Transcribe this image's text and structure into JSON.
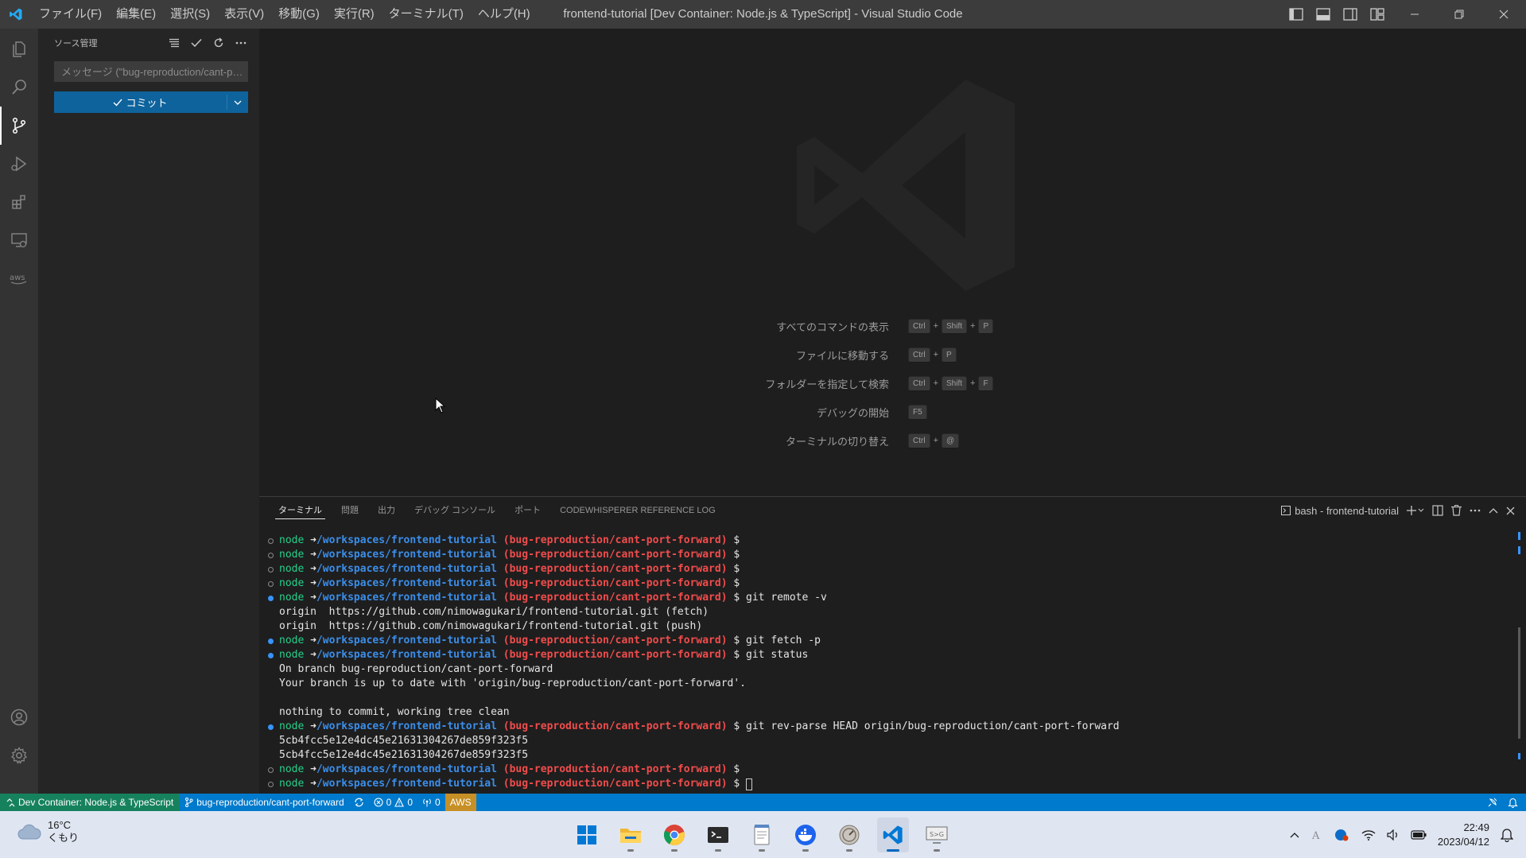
{
  "window": {
    "title": "frontend-tutorial [Dev Container: Node.js & TypeScript] - Visual Studio Code",
    "menu": [
      "ファイル(F)",
      "編集(E)",
      "選択(S)",
      "表示(V)",
      "移動(G)",
      "実行(R)",
      "ターミナル(T)",
      "ヘルプ(H)"
    ]
  },
  "sidebar": {
    "title": "ソース管理",
    "commit_message_placeholder": "メッセージ (\"bug-reproduction/cant-port-forward\" にコミットするには Ctrl+Enter)",
    "commit_button_label": "コミット"
  },
  "activity_bar": [
    "explorer-icon",
    "search-icon",
    "source-control-icon",
    "run-debug-icon",
    "extensions-icon",
    "remote-explorer-icon",
    "aws-icon",
    "accounts-icon",
    "manage-gear-icon"
  ],
  "editor": {
    "shortcuts": [
      {
        "label": "すべてのコマンドの表示",
        "keys": [
          "Ctrl",
          "Shift",
          "P"
        ]
      },
      {
        "label": "ファイルに移動する",
        "keys": [
          "Ctrl",
          "P"
        ]
      },
      {
        "label": "フォルダーを指定して検索",
        "keys": [
          "Ctrl",
          "Shift",
          "F"
        ]
      },
      {
        "label": "デバッグの開始",
        "keys": [
          "F5"
        ]
      },
      {
        "label": "ターミナルの切り替え",
        "keys": [
          "Ctrl",
          "@"
        ]
      }
    ]
  },
  "panel": {
    "tabs": [
      "ターミナル",
      "問題",
      "出力",
      "デバッグ コンソール",
      "ポート",
      "CODEWHISPERER REFERENCE LOG"
    ],
    "active_tab": 0,
    "terminal_name": "bash - frontend-tutorial",
    "prompt": {
      "user": "node",
      "arrow": "➜",
      "path": "/workspaces/frontend-tutorial",
      "branch": "(bug-reproduction/cant-port-forward)",
      "suffix": "$"
    },
    "lines": [
      {
        "type": "prompt",
        "deco": "circle",
        "cmd": ""
      },
      {
        "type": "prompt",
        "deco": "circle",
        "cmd": ""
      },
      {
        "type": "prompt",
        "deco": "circle",
        "cmd": ""
      },
      {
        "type": "prompt",
        "deco": "circle",
        "cmd": ""
      },
      {
        "type": "prompt",
        "deco": "dot",
        "cmd": "git remote -v"
      },
      {
        "type": "output",
        "text": "origin  https://github.com/nimowagukari/frontend-tutorial.git (fetch)"
      },
      {
        "type": "output",
        "text": "origin  https://github.com/nimowagukari/frontend-tutorial.git (push)"
      },
      {
        "type": "prompt",
        "deco": "dot",
        "cmd": "git fetch -p"
      },
      {
        "type": "prompt",
        "deco": "dot",
        "cmd": "git status"
      },
      {
        "type": "output",
        "text": "On branch bug-reproduction/cant-port-forward"
      },
      {
        "type": "output",
        "text": "Your branch is up to date with 'origin/bug-reproduction/cant-port-forward'."
      },
      {
        "type": "output",
        "text": ""
      },
      {
        "type": "output",
        "text": "nothing to commit, working tree clean"
      },
      {
        "type": "prompt",
        "deco": "dot",
        "cmd": "git rev-parse HEAD origin/bug-reproduction/cant-port-forward"
      },
      {
        "type": "output",
        "text": "5cb4fcc5e12e4dc45e21631304267de859f323f5"
      },
      {
        "type": "output",
        "text": "5cb4fcc5e12e4dc45e21631304267de859f323f5"
      },
      {
        "type": "prompt",
        "deco": "circle",
        "cmd": ""
      },
      {
        "type": "prompt",
        "deco": "circle",
        "cmd": "",
        "cursor": true
      }
    ]
  },
  "statusbar": {
    "remote": "Dev Container: Node.js & TypeScript",
    "branch": "bug-reproduction/cant-port-forward",
    "errors": "0",
    "warnings": "0",
    "ports": "0",
    "aws": "AWS"
  },
  "taskbar": {
    "temperature": "16°C",
    "weather": "くもり",
    "time": "22:49",
    "date": "2023/04/12",
    "apps": [
      "windows-start-icon",
      "file-explorer-icon",
      "chrome-icon",
      "terminal-icon",
      "notepad-icon",
      "docker-icon",
      "app-icon",
      "vscode-icon",
      "remote-desktop-icon"
    ]
  },
  "colors": {
    "accent": "#007acc",
    "remote": "#16825d",
    "aws": "#c69026",
    "prompt_user": "#23d18b",
    "prompt_path": "#3b8eea",
    "prompt_branch": "#f14c4c"
  }
}
